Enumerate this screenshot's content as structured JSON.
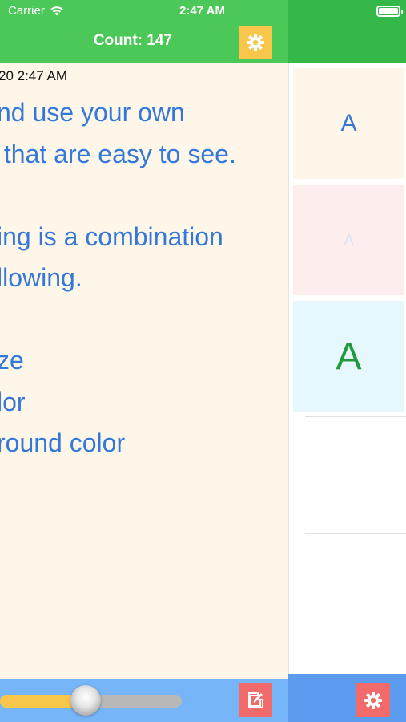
{
  "status_bar": {
    "carrier": "Carrier",
    "time": "2:47 AM",
    "wifi_icon": "wifi-icon",
    "battery_icon": "battery-icon"
  },
  "header": {
    "title": "Count: 147",
    "settings_icon": "gear-icon"
  },
  "content": {
    "timestamp": "20 2:47 AM",
    "text": "nd use your own\n that are easy to see.\n\ning is a combination\nllowing.\n\nze\nlor\nround color",
    "text_color": "#3478d8",
    "background_color": "#fdf6e9"
  },
  "side_samples": [
    {
      "label": "A",
      "color": "#3478d8",
      "background": "#fdf6e9"
    },
    {
      "label": "A",
      "color": "#d8e2f7",
      "background": "#fdeeed"
    },
    {
      "label": "A",
      "color": "#1f9a3c",
      "background": "#e6f8fd"
    }
  ],
  "footer": {
    "slider_value": 0.47,
    "edit_icon": "edit-icon",
    "settings_icon": "gear-icon"
  },
  "colors": {
    "header_green": "#4cc859",
    "accent_yellow": "#f7c64a",
    "accent_red": "#f26b6b",
    "footer_blue": "#76b5f7"
  }
}
